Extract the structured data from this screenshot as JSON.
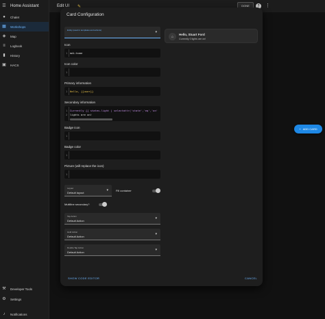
{
  "app": {
    "title": "Home Assistant"
  },
  "sidebar": {
    "items": [
      {
        "label": "Chalet",
        "icon": "person-icon",
        "active": false
      },
      {
        "label": "Workshops",
        "icon": "dashboard-icon",
        "active": true
      },
      {
        "label": "Map",
        "icon": "map-icon",
        "active": false
      },
      {
        "label": "Logbook",
        "icon": "logbook-icon",
        "active": false
      },
      {
        "label": "History",
        "icon": "history-icon",
        "active": false
      },
      {
        "label": "HACS",
        "icon": "hacs-icon",
        "active": false
      }
    ],
    "bottom_items": [
      {
        "label": "Developer Tools",
        "icon": "wrench-icon"
      },
      {
        "label": "Settings",
        "icon": "gear-icon"
      },
      {
        "label": "Notifications",
        "icon": "bell-icon"
      }
    ]
  },
  "topbar": {
    "title": "Edit UI",
    "done_label": "DONE",
    "help": "?"
  },
  "add_card": {
    "label": "ADD CARD"
  },
  "dialog": {
    "title": "Card Configuration",
    "entity_select": {
      "label": "Entity (used in templates and actions)",
      "value": ""
    },
    "fields": {
      "icon": {
        "label": "Icon",
        "line": "1",
        "code": "mdi:home"
      },
      "icon_color": {
        "label": "Icon color",
        "line": "1",
        "code": ""
      },
      "primary": {
        "label": "Primary information",
        "line": "1",
        "code": "Hello, {{user}}"
      },
      "secondary": {
        "label": "Secondary information",
        "line1": "1",
        "line2": "2",
        "code1": "Currently {{ states.light | selectattr('state','eq','on'",
        "code2": "lights are on!"
      },
      "badge_icon": {
        "label": "Badge icon",
        "line": "1",
        "code": ""
      },
      "badge_color": {
        "label": "Badge color",
        "line": "1",
        "code": ""
      },
      "picture": {
        "label": "Picture (will replace the icon)",
        "line": "1",
        "code": ""
      }
    },
    "layout": {
      "label": "Layout",
      "value": "Default layout"
    },
    "fill_container": {
      "label": "Fill container"
    },
    "multiline": {
      "label": "Multiline secondary?"
    },
    "actions": [
      {
        "label": "Tap Action",
        "value": "Default Action"
      },
      {
        "label": "Hold Action",
        "value": "Default Action"
      },
      {
        "label": "Double Tap Action",
        "value": "Default Action"
      }
    ],
    "show_code_label": "SHOW CODE EDITOR",
    "cancel_label": "CANCEL"
  },
  "preview": {
    "title": "Hello, Stuart Ford",
    "subtitle": "Currently 0 lights are on!"
  }
}
